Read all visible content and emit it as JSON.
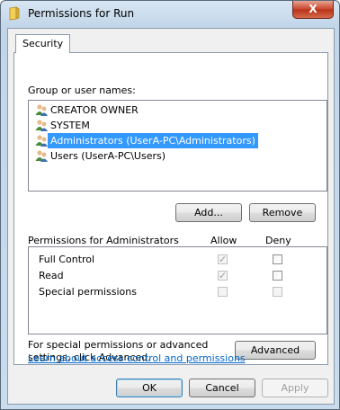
{
  "window": {
    "title": "Permissions for Run",
    "close_glyph": "X"
  },
  "tabs": [
    {
      "label": "Security"
    }
  ],
  "group_section": {
    "label": "Group or user names:",
    "items": [
      {
        "name": "CREATOR OWNER",
        "selected": false
      },
      {
        "name": "SYSTEM",
        "selected": false
      },
      {
        "name": "Administrators (UserA-PC\\Administrators)",
        "selected": true
      },
      {
        "name": "Users (UserA-PC\\Users)",
        "selected": false
      }
    ],
    "add_label": "Add...",
    "remove_label": "Remove"
  },
  "permissions": {
    "header": "Permissions for Administrators",
    "allow_label": "Allow",
    "deny_label": "Deny",
    "rows": [
      {
        "name": "Full Control",
        "allow": true,
        "deny": false
      },
      {
        "name": "Read",
        "allow": true,
        "deny": false
      },
      {
        "name": "Special permissions",
        "allow": false,
        "deny": false
      }
    ]
  },
  "advanced": {
    "text": "For special permissions or advanced settings, click Advanced.",
    "button_label": "Advanced"
  },
  "link_text": "Learn about access control and permissions",
  "footer": {
    "ok_label": "OK",
    "cancel_label": "Cancel",
    "apply_label": "Apply"
  },
  "icons": {
    "title": "folder-icon",
    "user": "users-icon"
  }
}
